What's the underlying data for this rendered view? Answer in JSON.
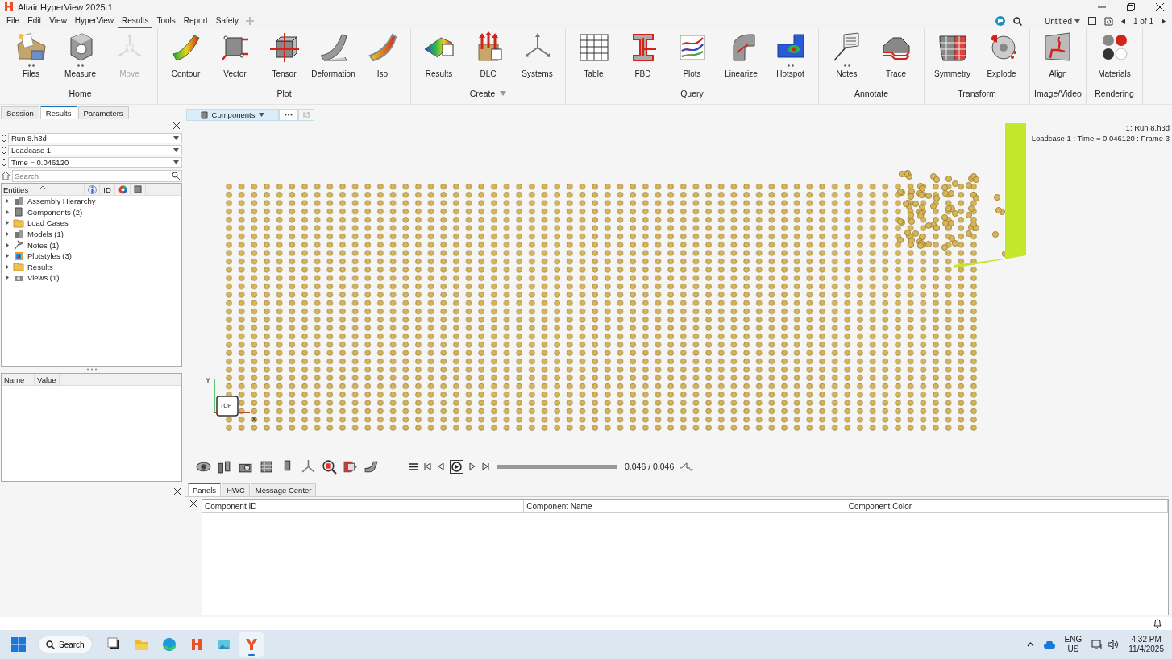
{
  "window": {
    "title": "Altair HyperView 2025.1"
  },
  "menu": [
    {
      "label": "File",
      "selected": false
    },
    {
      "label": "Edit",
      "selected": false
    },
    {
      "label": "View",
      "selected": false
    },
    {
      "label": "HyperView",
      "selected": false
    },
    {
      "label": "Results",
      "selected": true
    },
    {
      "label": "Tools",
      "selected": false
    },
    {
      "label": "Report",
      "selected": false
    },
    {
      "label": "Safety",
      "selected": false
    }
  ],
  "session": {
    "title": "Untitled",
    "page_counter": "1 of 1"
  },
  "ribbon": [
    {
      "group": "Home",
      "dropdown": false,
      "tools": [
        {
          "label": "Files",
          "more": true,
          "disabled": false
        },
        {
          "label": "Measure",
          "more": true,
          "disabled": false
        },
        {
          "label": "Move",
          "more": false,
          "disabled": true
        }
      ]
    },
    {
      "group": "Plot",
      "dropdown": false,
      "tools": [
        {
          "label": "Contour",
          "more": false,
          "disabled": false
        },
        {
          "label": "Vector",
          "more": false,
          "disabled": false
        },
        {
          "label": "Tensor",
          "more": false,
          "disabled": false
        },
        {
          "label": "Deformation",
          "more": false,
          "disabled": false
        },
        {
          "label": "Iso",
          "more": false,
          "disabled": false
        }
      ]
    },
    {
      "group": "Create",
      "dropdown": true,
      "tools": [
        {
          "label": "Results",
          "more": false,
          "disabled": false
        },
        {
          "label": "DLC",
          "more": false,
          "disabled": false
        },
        {
          "label": "Systems",
          "more": false,
          "disabled": false
        }
      ]
    },
    {
      "group": "Query",
      "dropdown": false,
      "tools": [
        {
          "label": "Table",
          "more": false,
          "disabled": false
        },
        {
          "label": "FBD",
          "more": false,
          "disabled": false
        },
        {
          "label": "Plots",
          "more": false,
          "disabled": false
        },
        {
          "label": "Linearize",
          "more": false,
          "disabled": false
        },
        {
          "label": "Hotspot",
          "more": true,
          "disabled": false
        }
      ]
    },
    {
      "group": "Annotate",
      "dropdown": false,
      "tools": [
        {
          "label": "Notes",
          "more": true,
          "disabled": false
        },
        {
          "label": "Trace",
          "more": false,
          "disabled": false
        }
      ]
    },
    {
      "group": "Transform",
      "dropdown": false,
      "tools": [
        {
          "label": "Symmetry",
          "more": false,
          "disabled": false
        },
        {
          "label": "Explode",
          "more": false,
          "disabled": false
        }
      ]
    },
    {
      "group": "Image/Video",
      "dropdown": false,
      "tools": [
        {
          "label": "Align",
          "more": false,
          "disabled": false
        }
      ]
    },
    {
      "group": "Rendering",
      "dropdown": false,
      "tools": [
        {
          "label": "Materials",
          "more": false,
          "disabled": false
        }
      ]
    }
  ],
  "side_panel": {
    "tabs": [
      {
        "label": "Session",
        "selected": false
      },
      {
        "label": "Results",
        "selected": true
      },
      {
        "label": "Parameters",
        "selected": false
      }
    ],
    "selectors": [
      {
        "value": "Run 8.h3d"
      },
      {
        "value": "Loadcase 1"
      },
      {
        "value": "Time = 0.046120"
      }
    ],
    "search": {
      "placeholder": "Search"
    },
    "entity_columns": {
      "entities": "Entities",
      "id": "ID"
    },
    "tree": [
      {
        "label": "Assembly Hierarchy",
        "expanded": false
      },
      {
        "label": "Components (2)",
        "expanded": false
      },
      {
        "label": "Load Cases",
        "expanded": false
      },
      {
        "label": "Models (1)",
        "expanded": false
      },
      {
        "label": "Notes (1)",
        "expanded": false
      },
      {
        "label": "Plotstyles (3)",
        "expanded": false
      },
      {
        "label": "Results",
        "expanded": false
      },
      {
        "label": "Views (1)",
        "expanded": false
      }
    ],
    "property_columns": [
      "Name",
      "Value"
    ]
  },
  "viewport": {
    "entity_selector": "Components",
    "model_label": "1: Run 8.h3d",
    "status_label": "Loadcase 1 : Time = 0.046120 : Frame 3",
    "view_cube": "TOP",
    "axis_labels": [
      "Y",
      "X"
    ]
  },
  "animation": {
    "level": 1,
    "time": "0.046 / 0.046"
  },
  "bottom_panel": {
    "tabs": [
      {
        "label": "Panels",
        "selected": true
      },
      {
        "label": "HWC",
        "selected": false
      },
      {
        "label": "Message Center",
        "selected": false
      }
    ],
    "columns": [
      "Component ID",
      "Component Name",
      "Component Color"
    ]
  },
  "taskbar": {
    "search": "Search",
    "apps": [
      {
        "selected": false
      },
      {
        "selected": false
      },
      {
        "selected": false
      },
      {
        "selected": false
      },
      {
        "selected": false
      },
      {
        "selected": true
      }
    ],
    "language": "ENG",
    "region": "US",
    "time": "4:32 PM",
    "date": "11/4/2025"
  }
}
